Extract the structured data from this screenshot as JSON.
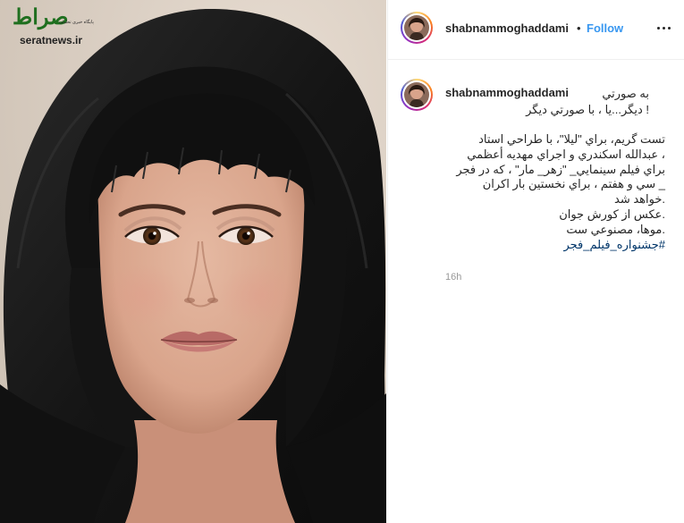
{
  "watermark": {
    "logo_text": "صراط",
    "tagline": "پایگاه خبری تحلیلی",
    "url": "seratnews.ir"
  },
  "header": {
    "username": "shabnammoghaddami",
    "separator": "•",
    "follow_label": "Follow"
  },
  "caption": {
    "username": "shabnammoghaddami",
    "inline_text": "به صورتي",
    "line_2": "! ديگر...يا ، با صورتي ديگر",
    "body": [
      "تست گريم، براي \"ليلا\"، با طراحي استاد",
      "، عبدالله اسكندري و اجراي مهديه أعظمي",
      "براي فيلم سينمايي_ \"زهر_ مار\" ، كه در فجر",
      "_ سي و هفتم ، براي نخستين بار اكران",
      ".خواهد شد",
      ".عكس از كورش جوان",
      ".موها، مصنوعي ست"
    ],
    "hashtag": "#جشنواره_فيلم_فجر"
  },
  "timestamp": "16h",
  "icons": {
    "more": "more-options-icon",
    "avatar": "profile-avatar"
  },
  "colors": {
    "follow_blue": "#3897f0",
    "hashtag_blue": "#003569",
    "text": "#262626",
    "muted": "#999999",
    "divider": "#efefef"
  }
}
